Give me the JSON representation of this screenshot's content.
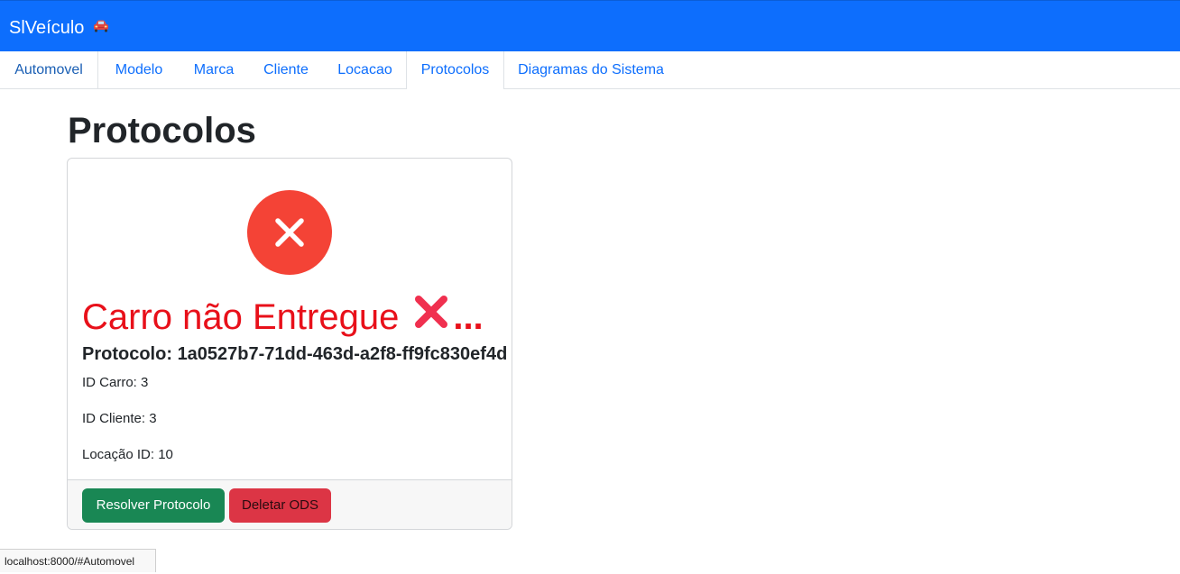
{
  "navbar": {
    "brand": "SlVeículo",
    "brand_icon": "car-icon",
    "background": "#0d6efd"
  },
  "tabs": [
    {
      "label": "Automovel"
    },
    {
      "label": "Modelo"
    },
    {
      "label": "Marca"
    },
    {
      "label": "Cliente"
    },
    {
      "label": "Locacao"
    },
    {
      "label": "Protocolos"
    },
    {
      "label": "Diagramas do Sistema"
    }
  ],
  "page": {
    "title": "Protocolos"
  },
  "card": {
    "status_icon": "error-circle-icon",
    "status_title": "Carro não Entregue",
    "status_emoji_icon": "cross-mark-icon",
    "status_overflow": "...",
    "protocol_label": "Protocolo:",
    "protocol_id": "1a0527b7-71dd-463d-a2f8-ff9fc830ef4d",
    "fields": [
      {
        "text": "ID Carro: 3"
      },
      {
        "text": "ID Cliente: 3"
      },
      {
        "text": "Locação ID: 10"
      }
    ],
    "buttons": {
      "resolve": "Resolver Protocolo",
      "delete": "Deletar ODS"
    },
    "colors": {
      "status_red": "#e8101a",
      "success": "#198754",
      "danger": "#dc3545"
    }
  },
  "statusbar": {
    "url": "localhost:8000/#Automovel"
  }
}
